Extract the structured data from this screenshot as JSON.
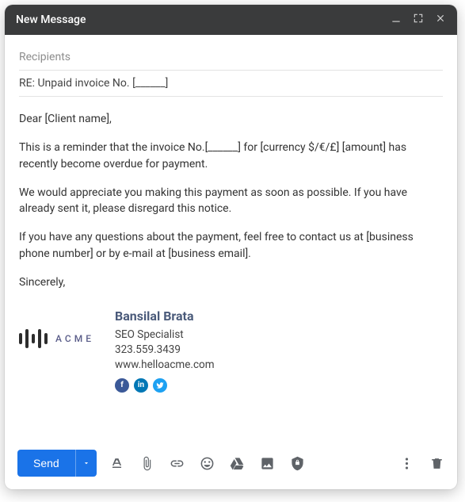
{
  "window": {
    "title": "New Message"
  },
  "fields": {
    "recipients_placeholder": "Recipients",
    "subject": "RE: Unpaid  invoice No. [______]"
  },
  "body": {
    "p1": "Dear [Client name],",
    "p2": "This is a reminder that the invoice No.[______] for [currency $/€/£] [amount] has recently become overdue for payment.",
    "p3": "We would appreciate you making this payment as soon as possible. If you have already sent it, please disregard this notice.",
    "p4": "If you have any questions about the payment, feel free to contact us at [business phone number] or by e-mail at [business email].",
    "p5": "Sincerely,"
  },
  "signature": {
    "brand": "ACME",
    "name": "Bansilal Brata",
    "title": "SEO Specialist",
    "phone": "323.559.3439",
    "website": "www.helloacme.com"
  },
  "actions": {
    "send_label": "Send"
  },
  "icons": {
    "minimize": "minimize-icon",
    "expand": "expand-icon",
    "close": "close-icon",
    "format": "text-format-icon",
    "attach": "attach-file-icon",
    "link": "insert-link-icon",
    "emoji": "emoji-icon",
    "drive": "drive-icon",
    "photo": "insert-photo-icon",
    "confidential": "confidential-mode-icon",
    "more": "more-options-icon",
    "trash": "discard-draft-icon",
    "facebook": "facebook-icon",
    "linkedin": "linkedin-icon",
    "twitter": "twitter-icon"
  },
  "colors": {
    "primary": "#1a73e8",
    "header_bg": "#3a3b3c"
  }
}
